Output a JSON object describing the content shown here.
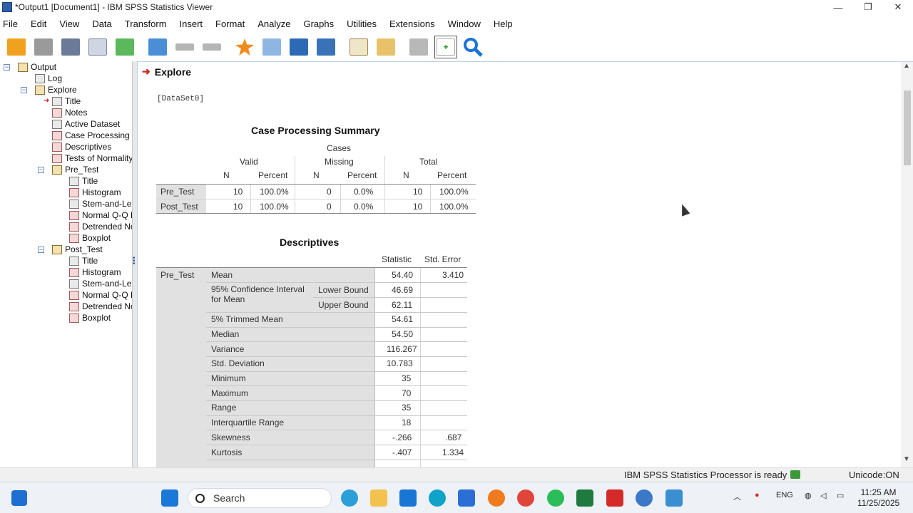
{
  "window": {
    "title": "*Output1 [Document1] - IBM SPSS Statistics Viewer",
    "buttons": [
      "—",
      "❐",
      "✕"
    ]
  },
  "menu": [
    "File",
    "Edit",
    "View",
    "Data",
    "Transform",
    "Insert",
    "Format",
    "Analyze",
    "Graphs",
    "Utilities",
    "Extensions",
    "Window",
    "Help"
  ],
  "toolbar": {
    "icons": [
      "open-icon",
      "save-icon",
      "print-icon",
      "print-preview-icon",
      "export-icon",
      "recall-dialog-icon",
      "undo-icon",
      "redo-icon",
      "goto-data-icon",
      "goto-case-icon",
      "goto-variable-icon",
      "variables-icon",
      "designate-window-icon",
      "script-icon",
      "show-all-icon",
      "insert-output-icon",
      "search-icon"
    ],
    "colors": {
      "open": "#f0a21e",
      "save": "#8a8a8a",
      "print": "#5a6b8c",
      "export": "#3aa84a",
      "star": "#f08a1e",
      "search": "#1a73d6"
    }
  },
  "tree": {
    "root": "Output",
    "log": "Log",
    "explore": "Explore",
    "explore_children": [
      "Title",
      "Notes",
      "Active Dataset",
      "Case Processing",
      "Descriptives",
      "Tests of Normality"
    ],
    "pre_test": "Pre_Test",
    "pre_children": [
      "Title",
      "Histogram",
      "Stem-and-Le",
      "Normal Q-Q F",
      "Detrended No",
      "Boxplot"
    ],
    "post_test": "Post_Test",
    "post_children": [
      "Title",
      "Histogram",
      "Stem-and-Le",
      "Normal Q-Q F",
      "Detrended No",
      "Boxplot"
    ]
  },
  "output": {
    "heading": "Explore",
    "dataset": "[DataSet0]",
    "case_summary": {
      "title": "Case Processing Summary",
      "cases": "Cases",
      "groups": [
        "Valid",
        "Missing",
        "Total"
      ],
      "cols": [
        "N",
        "Percent",
        "N",
        "Percent",
        "N",
        "Percent"
      ],
      "rows": [
        {
          "label": "Pre_Test",
          "values": [
            "10",
            "100.0%",
            "0",
            "0.0%",
            "10",
            "100.0%"
          ]
        },
        {
          "label": "Post_Test",
          "values": [
            "10",
            "100.0%",
            "0",
            "0.0%",
            "10",
            "100.0%"
          ]
        }
      ]
    },
    "descriptives": {
      "title": "Descriptives",
      "statistic_header": "Statistic",
      "std_error_header": "Std. Error",
      "group": "Pre_Test",
      "rows": [
        {
          "label": "Mean",
          "sub": "",
          "stat": "54.40",
          "se": "3.410"
        },
        {
          "label": "95% Confidence Interval for Mean",
          "sub": "Lower Bound",
          "stat": "46.69",
          "se": ""
        },
        {
          "label": "",
          "sub": "Upper Bound",
          "stat": "62.11",
          "se": ""
        },
        {
          "label": "5% Trimmed Mean",
          "sub": "",
          "stat": "54.61",
          "se": ""
        },
        {
          "label": "Median",
          "sub": "",
          "stat": "54.50",
          "se": ""
        },
        {
          "label": "Variance",
          "sub": "",
          "stat": "116.267",
          "se": ""
        },
        {
          "label": "Std. Deviation",
          "sub": "",
          "stat": "10.783",
          "se": ""
        },
        {
          "label": "Minimum",
          "sub": "",
          "stat": "35",
          "se": ""
        },
        {
          "label": "Maximum",
          "sub": "",
          "stat": "70",
          "se": ""
        },
        {
          "label": "Range",
          "sub": "",
          "stat": "35",
          "se": ""
        },
        {
          "label": "Interquartile Range",
          "sub": "",
          "stat": "18",
          "se": ""
        },
        {
          "label": "Skewness",
          "sub": "",
          "stat": "-.266",
          "se": ".687"
        },
        {
          "label": "Kurtosis",
          "sub": "",
          "stat": "-.407",
          "se": "1.334"
        }
      ]
    }
  },
  "status": {
    "processor": "IBM SPSS Statistics Processor is ready",
    "unicode": "Unicode:ON"
  },
  "taskbar": {
    "search_placeholder": "Search",
    "lang": "ENG",
    "time": "11:25 AM",
    "date": "11/25/2025"
  }
}
